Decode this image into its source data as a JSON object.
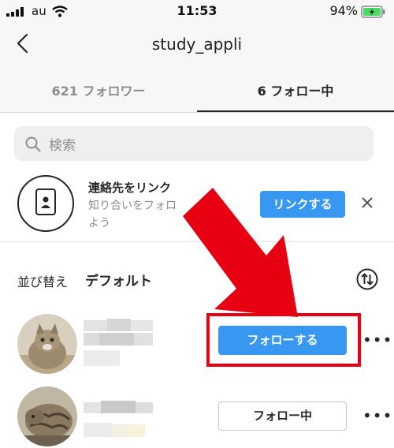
{
  "status_bar": {
    "carrier": "au",
    "time": "11:53",
    "battery": "94%"
  },
  "header": {
    "title": "study_appli"
  },
  "tabs": [
    {
      "label": "621 フォロワー",
      "active": false
    },
    {
      "label": "6 フォロー中",
      "active": true
    }
  ],
  "search": {
    "placeholder": "検索"
  },
  "contacts": {
    "title": "連絡先をリンク",
    "subtitle_line1": "知り合いをフォロ",
    "subtitle_line2": "よう",
    "button": "リンクする"
  },
  "sort": {
    "label": "並び替え",
    "value": "デフォルト"
  },
  "users": [
    {
      "button": "フォローする",
      "button_style": "primary"
    },
    {
      "button": "フォロー中",
      "button_style": "secondary"
    }
  ],
  "colors": {
    "accent": "#3897f0",
    "highlight": "#e60012"
  }
}
